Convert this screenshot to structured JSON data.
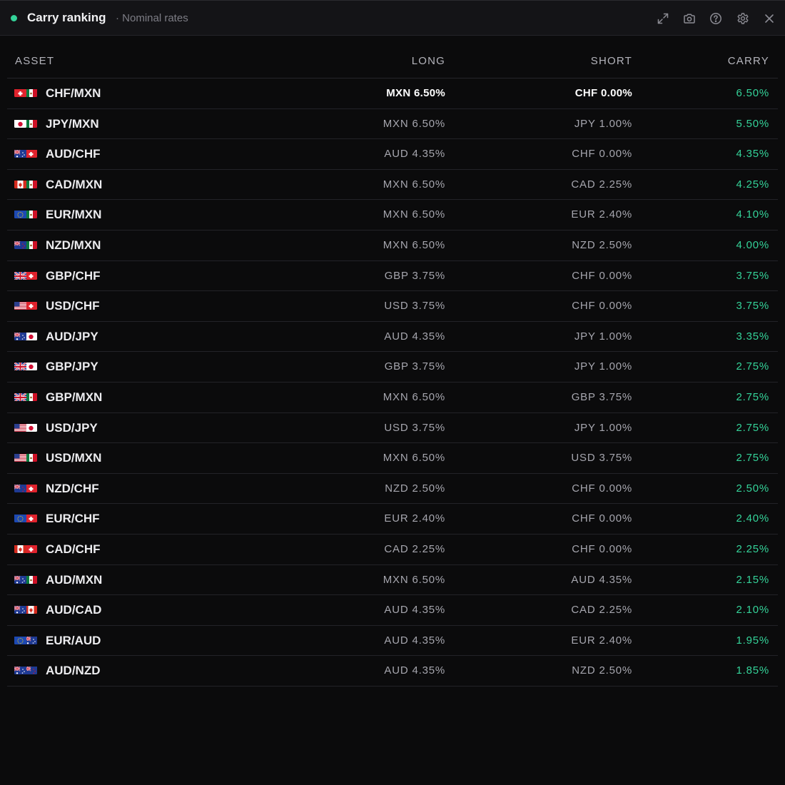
{
  "header": {
    "title": "Carry ranking",
    "subtitle": "· Nominal rates",
    "status_color": "#34d399",
    "icons": [
      "expand-icon",
      "camera-icon",
      "help-icon",
      "settings-icon",
      "close-icon"
    ]
  },
  "table": {
    "columns": {
      "asset": "ASSET",
      "long": "LONG",
      "short": "SHORT",
      "carry": "CARRY"
    },
    "carry_color": "#34d399",
    "rows": [
      {
        "pair": "CHF/MXN",
        "base": "CHF",
        "quote": "MXN",
        "long": "MXN 6.50%",
        "short": "CHF 0.00%",
        "carry": "6.50%"
      },
      {
        "pair": "JPY/MXN",
        "base": "JPY",
        "quote": "MXN",
        "long": "MXN 6.50%",
        "short": "JPY 1.00%",
        "carry": "5.50%"
      },
      {
        "pair": "AUD/CHF",
        "base": "AUD",
        "quote": "CHF",
        "long": "AUD 4.35%",
        "short": "CHF 0.00%",
        "carry": "4.35%"
      },
      {
        "pair": "CAD/MXN",
        "base": "CAD",
        "quote": "MXN",
        "long": "MXN 6.50%",
        "short": "CAD 2.25%",
        "carry": "4.25%"
      },
      {
        "pair": "EUR/MXN",
        "base": "EUR",
        "quote": "MXN",
        "long": "MXN 6.50%",
        "short": "EUR 2.40%",
        "carry": "4.10%"
      },
      {
        "pair": "NZD/MXN",
        "base": "NZD",
        "quote": "MXN",
        "long": "MXN 6.50%",
        "short": "NZD 2.50%",
        "carry": "4.00%"
      },
      {
        "pair": "GBP/CHF",
        "base": "GBP",
        "quote": "CHF",
        "long": "GBP 3.75%",
        "short": "CHF 0.00%",
        "carry": "3.75%"
      },
      {
        "pair": "USD/CHF",
        "base": "USD",
        "quote": "CHF",
        "long": "USD 3.75%",
        "short": "CHF 0.00%",
        "carry": "3.75%"
      },
      {
        "pair": "AUD/JPY",
        "base": "AUD",
        "quote": "JPY",
        "long": "AUD 4.35%",
        "short": "JPY 1.00%",
        "carry": "3.35%"
      },
      {
        "pair": "GBP/JPY",
        "base": "GBP",
        "quote": "JPY",
        "long": "GBP 3.75%",
        "short": "JPY 1.00%",
        "carry": "2.75%"
      },
      {
        "pair": "GBP/MXN",
        "base": "GBP",
        "quote": "MXN",
        "long": "MXN 6.50%",
        "short": "GBP 3.75%",
        "carry": "2.75%"
      },
      {
        "pair": "USD/JPY",
        "base": "USD",
        "quote": "JPY",
        "long": "USD 3.75%",
        "short": "JPY 1.00%",
        "carry": "2.75%"
      },
      {
        "pair": "USD/MXN",
        "base": "USD",
        "quote": "MXN",
        "long": "MXN 6.50%",
        "short": "USD 3.75%",
        "carry": "2.75%"
      },
      {
        "pair": "NZD/CHF",
        "base": "NZD",
        "quote": "CHF",
        "long": "NZD 2.50%",
        "short": "CHF 0.00%",
        "carry": "2.50%"
      },
      {
        "pair": "EUR/CHF",
        "base": "EUR",
        "quote": "CHF",
        "long": "EUR 2.40%",
        "short": "CHF 0.00%",
        "carry": "2.40%"
      },
      {
        "pair": "CAD/CHF",
        "base": "CAD",
        "quote": "CHF",
        "long": "CAD 2.25%",
        "short": "CHF 0.00%",
        "carry": "2.25%"
      },
      {
        "pair": "AUD/MXN",
        "base": "AUD",
        "quote": "MXN",
        "long": "MXN 6.50%",
        "short": "AUD 4.35%",
        "carry": "2.15%"
      },
      {
        "pair": "AUD/CAD",
        "base": "AUD",
        "quote": "CAD",
        "long": "AUD 4.35%",
        "short": "CAD 2.25%",
        "carry": "2.10%"
      },
      {
        "pair": "EUR/AUD",
        "base": "EUR",
        "quote": "AUD",
        "long": "AUD 4.35%",
        "short": "EUR 2.40%",
        "carry": "1.95%"
      },
      {
        "pair": "AUD/NZD",
        "base": "AUD",
        "quote": "NZD",
        "long": "AUD 4.35%",
        "short": "NZD 2.50%",
        "carry": "1.85%"
      }
    ]
  }
}
